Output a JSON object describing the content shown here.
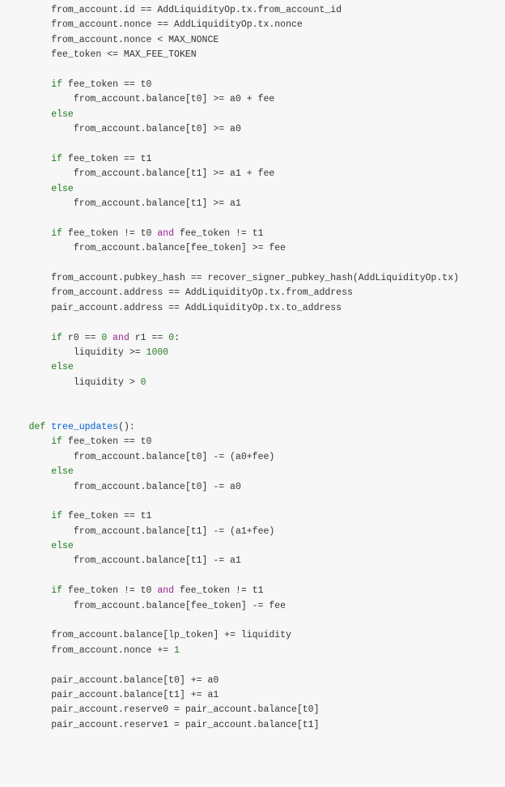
{
  "code": {
    "lines": [
      {
        "indent": 2,
        "segments": [
          {
            "t": "from_account.id == AddLiquidityOp.tx.from_account_id",
            "c": "txt"
          }
        ]
      },
      {
        "indent": 2,
        "segments": [
          {
            "t": "from_account.nonce == AddLiquidityOp.tx.nonce",
            "c": "txt"
          }
        ]
      },
      {
        "indent": 2,
        "segments": [
          {
            "t": "from_account.nonce < MAX_NONCE",
            "c": "txt"
          }
        ]
      },
      {
        "indent": 2,
        "segments": [
          {
            "t": "fee_token <= MAX_FEE_TOKEN",
            "c": "txt"
          }
        ]
      },
      {
        "indent": 0,
        "segments": []
      },
      {
        "indent": 2,
        "segments": [
          {
            "t": "if",
            "c": "kw"
          },
          {
            "t": " fee_token == t0",
            "c": "txt"
          }
        ]
      },
      {
        "indent": 3,
        "segments": [
          {
            "t": "from_account.balance[t0] >= a0 + fee",
            "c": "txt"
          }
        ]
      },
      {
        "indent": 2,
        "segments": [
          {
            "t": "else",
            "c": "kw"
          }
        ]
      },
      {
        "indent": 3,
        "segments": [
          {
            "t": "from_account.balance[t0] >= a0",
            "c": "txt"
          }
        ]
      },
      {
        "indent": 0,
        "segments": []
      },
      {
        "indent": 2,
        "segments": [
          {
            "t": "if",
            "c": "kw"
          },
          {
            "t": " fee_token == t1",
            "c": "txt"
          }
        ]
      },
      {
        "indent": 3,
        "segments": [
          {
            "t": "from_account.balance[t1] >= a1 + fee",
            "c": "txt"
          }
        ]
      },
      {
        "indent": 2,
        "segments": [
          {
            "t": "else",
            "c": "kw"
          }
        ]
      },
      {
        "indent": 3,
        "segments": [
          {
            "t": "from_account.balance[t1] >= a1",
            "c": "txt"
          }
        ]
      },
      {
        "indent": 0,
        "segments": []
      },
      {
        "indent": 2,
        "segments": [
          {
            "t": "if",
            "c": "kw"
          },
          {
            "t": " fee_token != t0 ",
            "c": "txt"
          },
          {
            "t": "and",
            "c": "op"
          },
          {
            "t": " fee_token != t1",
            "c": "txt"
          }
        ]
      },
      {
        "indent": 3,
        "segments": [
          {
            "t": "from_account.balance[fee_token] >= fee",
            "c": "txt"
          }
        ]
      },
      {
        "indent": 0,
        "segments": []
      },
      {
        "indent": 2,
        "segments": [
          {
            "t": "from_account.pubkey_hash == recover_signer_pubkey_hash(AddLiquidityOp.tx)",
            "c": "txt"
          }
        ]
      },
      {
        "indent": 2,
        "segments": [
          {
            "t": "from_account.address == AddLiquidityOp.tx.from_address",
            "c": "txt"
          }
        ]
      },
      {
        "indent": 2,
        "segments": [
          {
            "t": "pair_account.address == AddLiquidityOp.tx.to_address",
            "c": "txt"
          }
        ]
      },
      {
        "indent": 0,
        "segments": []
      },
      {
        "indent": 2,
        "segments": [
          {
            "t": "if",
            "c": "kw"
          },
          {
            "t": " r0 == ",
            "c": "txt"
          },
          {
            "t": "0",
            "c": "num"
          },
          {
            "t": " ",
            "c": "txt"
          },
          {
            "t": "and",
            "c": "op"
          },
          {
            "t": " r1 == ",
            "c": "txt"
          },
          {
            "t": "0",
            "c": "num"
          },
          {
            "t": ":",
            "c": "txt"
          }
        ]
      },
      {
        "indent": 3,
        "segments": [
          {
            "t": "liquidity >= ",
            "c": "txt"
          },
          {
            "t": "1000",
            "c": "num"
          }
        ]
      },
      {
        "indent": 2,
        "segments": [
          {
            "t": "else",
            "c": "kw"
          }
        ]
      },
      {
        "indent": 3,
        "segments": [
          {
            "t": "liquidity > ",
            "c": "txt"
          },
          {
            "t": "0",
            "c": "num"
          }
        ]
      },
      {
        "indent": 0,
        "segments": []
      },
      {
        "indent": 0,
        "segments": []
      },
      {
        "indent": 1,
        "segments": [
          {
            "t": "def",
            "c": "kw"
          },
          {
            "t": " ",
            "c": "txt"
          },
          {
            "t": "tree_updates",
            "c": "fn"
          },
          {
            "t": "():",
            "c": "txt"
          }
        ]
      },
      {
        "indent": 2,
        "segments": [
          {
            "t": "if",
            "c": "kw"
          },
          {
            "t": " fee_token == t0",
            "c": "txt"
          }
        ]
      },
      {
        "indent": 3,
        "segments": [
          {
            "t": "from_account.balance[t0] -= (a0+fee)",
            "c": "txt"
          }
        ]
      },
      {
        "indent": 2,
        "segments": [
          {
            "t": "else",
            "c": "kw"
          }
        ]
      },
      {
        "indent": 3,
        "segments": [
          {
            "t": "from_account.balance[t0] -= a0",
            "c": "txt"
          }
        ]
      },
      {
        "indent": 0,
        "segments": []
      },
      {
        "indent": 2,
        "segments": [
          {
            "t": "if",
            "c": "kw"
          },
          {
            "t": " fee_token == t1",
            "c": "txt"
          }
        ]
      },
      {
        "indent": 3,
        "segments": [
          {
            "t": "from_account.balance[t1] -= (a1+fee)",
            "c": "txt"
          }
        ]
      },
      {
        "indent": 2,
        "segments": [
          {
            "t": "else",
            "c": "kw"
          }
        ]
      },
      {
        "indent": 3,
        "segments": [
          {
            "t": "from_account.balance[t1] -= a1",
            "c": "txt"
          }
        ]
      },
      {
        "indent": 0,
        "segments": []
      },
      {
        "indent": 2,
        "segments": [
          {
            "t": "if",
            "c": "kw"
          },
          {
            "t": " fee_token != t0 ",
            "c": "txt"
          },
          {
            "t": "and",
            "c": "op"
          },
          {
            "t": " fee_token != t1",
            "c": "txt"
          }
        ]
      },
      {
        "indent": 3,
        "segments": [
          {
            "t": "from_account.balance[fee_token] -= fee",
            "c": "txt"
          }
        ]
      },
      {
        "indent": 0,
        "segments": []
      },
      {
        "indent": 2,
        "segments": [
          {
            "t": "from_account.balance[lp_token] += liquidity",
            "c": "txt"
          }
        ]
      },
      {
        "indent": 2,
        "segments": [
          {
            "t": "from_account.nonce += ",
            "c": "txt"
          },
          {
            "t": "1",
            "c": "num"
          }
        ]
      },
      {
        "indent": 0,
        "segments": []
      },
      {
        "indent": 2,
        "segments": [
          {
            "t": "pair_account.balance[t0] += a0",
            "c": "txt"
          }
        ]
      },
      {
        "indent": 2,
        "segments": [
          {
            "t": "pair_account.balance[t1] += a1",
            "c": "txt"
          }
        ]
      },
      {
        "indent": 2,
        "segments": [
          {
            "t": "pair_account.reserve0 = pair_account.balance[t0]",
            "c": "txt"
          }
        ]
      },
      {
        "indent": 2,
        "segments": [
          {
            "t": "pair_account.reserve1 = pair_account.balance[t1]",
            "c": "txt"
          }
        ]
      }
    ],
    "indentUnit": "    "
  }
}
